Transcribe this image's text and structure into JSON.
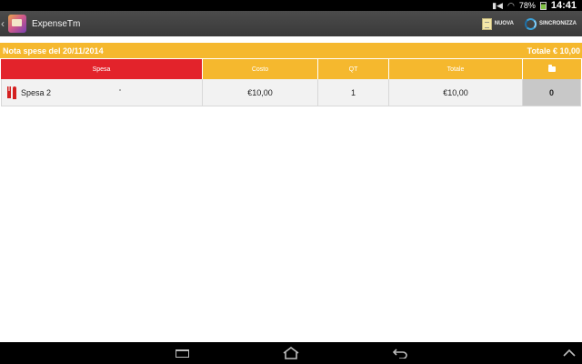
{
  "status_bar": {
    "battery_pct": "78%",
    "time": "14:41"
  },
  "action_bar": {
    "app_title": "ExpenseTm",
    "new_label": "NUOVA",
    "sync_label": "SINCRONIZZA"
  },
  "info_bar": {
    "note_title": "Nota spese del 20/11/2014",
    "total": "Totale € 10,00"
  },
  "table": {
    "headers": {
      "spesa": "Spesa",
      "costo": "Costo",
      "qt": "QT",
      "totale": "Totale"
    },
    "rows": [
      {
        "name": "Spesa 2",
        "cost": "€10,00",
        "qty": "1",
        "total": "€10,00",
        "attachments": "0"
      }
    ]
  },
  "colors": {
    "accent": "#f5b82e",
    "header_active": "#e3232b",
    "action_bar": "#404040"
  }
}
